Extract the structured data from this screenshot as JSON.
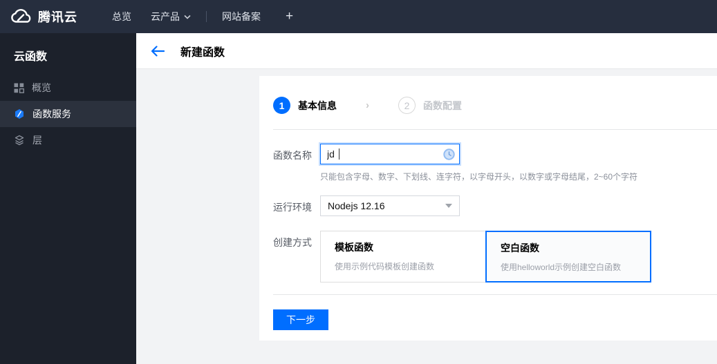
{
  "topbar": {
    "brand": "腾讯云",
    "nav_overview": "总览",
    "nav_products": "云产品",
    "nav_icp": "网站备案",
    "plus": "+"
  },
  "sidebar": {
    "title": "云函数",
    "items": [
      {
        "label": "概览",
        "icon": "grid-icon",
        "selected": false
      },
      {
        "label": "函数服务",
        "icon": "function-shield-icon",
        "selected": true
      },
      {
        "label": "层",
        "icon": "layers-icon",
        "selected": false
      }
    ]
  },
  "header": {
    "title": "新建函数"
  },
  "steps": [
    {
      "num": "1",
      "label": "基本信息",
      "active": true
    },
    {
      "num": "2",
      "label": "函数配置",
      "active": false
    }
  ],
  "form": {
    "name": {
      "label": "函数名称",
      "value": "jd",
      "hint": "只能包含字母、数字、下划线、连字符，以字母开头，以数字或字母结尾，2~60个字符"
    },
    "runtime": {
      "label": "运行环境",
      "value": "Nodejs 12.16"
    },
    "method": {
      "label": "创建方式",
      "options": [
        {
          "title": "模板函数",
          "desc": "使用示例代码模板创建函数",
          "selected": false
        },
        {
          "title": "空白函数",
          "desc": "使用helloworld示例创建空白函数",
          "selected": true
        }
      ]
    }
  },
  "footer": {
    "next_label": "下一步"
  },
  "colors": {
    "accent": "#006eff",
    "topbar_bg": "#262e3e",
    "sidebar_bg": "#1c212b",
    "sidebar_selected_bg": "#2b313d",
    "content_bg": "#f2f3f5"
  }
}
